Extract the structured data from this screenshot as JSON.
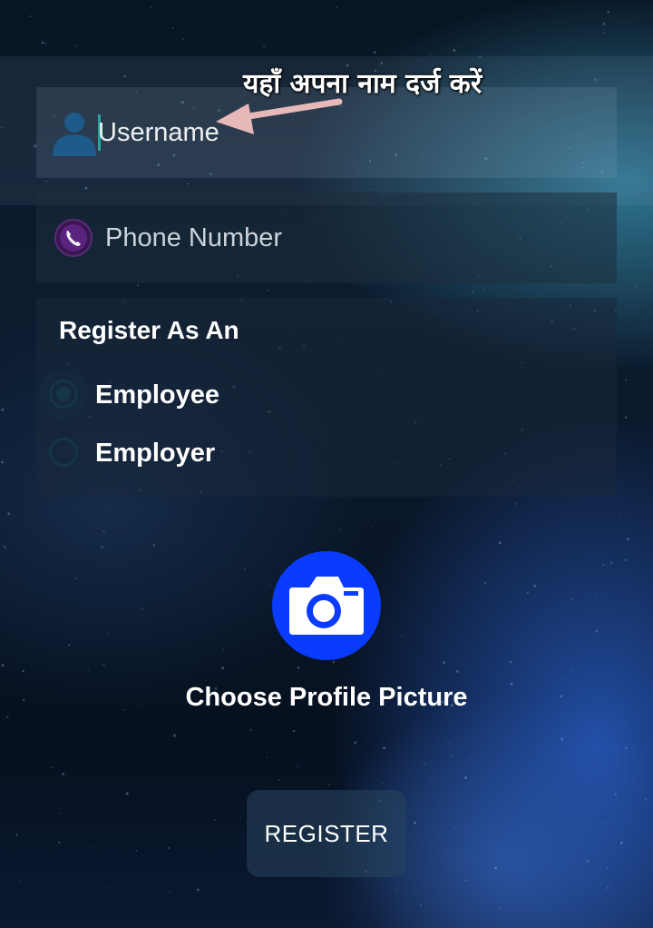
{
  "form": {
    "username": {
      "placeholder": "Username",
      "value": "",
      "icon": "user-icon"
    },
    "phone": {
      "placeholder": "Phone Number",
      "value": "",
      "icon": "phone-icon"
    },
    "register_as": {
      "heading": "Register As An",
      "options": [
        {
          "label": "Employee",
          "selected": true
        },
        {
          "label": "Employer",
          "selected": false
        }
      ]
    }
  },
  "annotation": {
    "text": "यहाँ अपना नाम दर्ज करें",
    "arrow_color": "#e6b8b8"
  },
  "profile_picture": {
    "label": "Choose Profile Picture",
    "icon": "camera-icon",
    "button_color": "#0a3cff"
  },
  "register_button": {
    "label": "REGISTER"
  }
}
